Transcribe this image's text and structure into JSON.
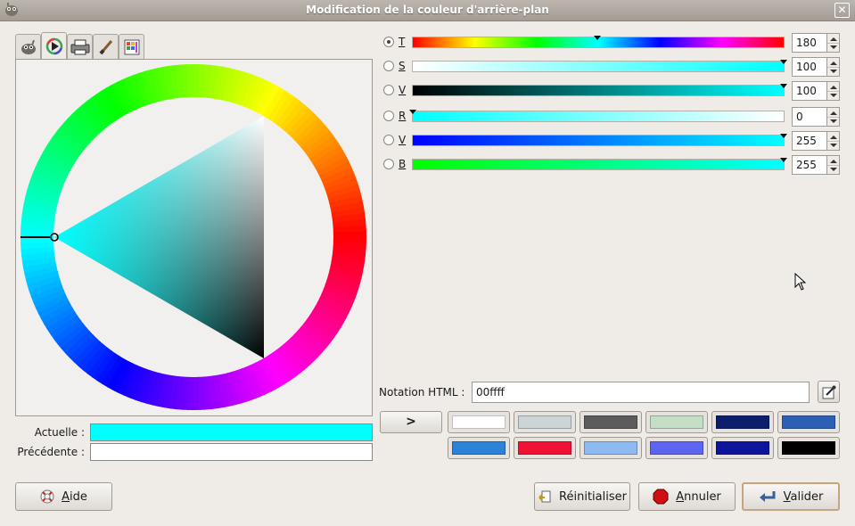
{
  "window": {
    "title": "Modification de la couleur d'arrière-plan",
    "close_glyph": "✕"
  },
  "tabs": [
    {
      "icon": "gimp-wilber-icon"
    },
    {
      "icon": "color-triangle-icon",
      "active": true
    },
    {
      "icon": "cmyk-printer-icon"
    },
    {
      "icon": "watercolor-brush-icon"
    },
    {
      "icon": "palette-scales-icon"
    }
  ],
  "swatches": {
    "current_label": "Actuelle :",
    "previous_label": "Précédente :",
    "current_color": "#00ffff",
    "previous_color": "#ffffff"
  },
  "sliders": [
    {
      "letter": "T",
      "value": "180",
      "checked": true
    },
    {
      "letter": "S",
      "value": "100",
      "checked": false
    },
    {
      "letter": "V",
      "value": "100",
      "checked": false
    },
    {
      "letter": "R",
      "value": "0",
      "checked": false
    },
    {
      "letter": "V",
      "value": "255",
      "checked": false
    },
    {
      "letter": "B",
      "value": "255",
      "checked": false
    }
  ],
  "html_notation": {
    "label": "Notation HTML :",
    "value": "00ffff"
  },
  "history": {
    "arrow": ">",
    "colors": [
      "#ffffff",
      "#ccd4d6",
      "#5c5c5c",
      "#c4dfc6",
      "#0c1d6b",
      "#2d5fb5",
      "#2b82d6",
      "#f01234",
      "#8ebaf2",
      "#5c64f0",
      "#0c149c",
      "#000000"
    ]
  },
  "buttons": {
    "help": "Aide",
    "reset": "Réinitialiser",
    "cancel": "Annuler",
    "ok": "Valider"
  }
}
